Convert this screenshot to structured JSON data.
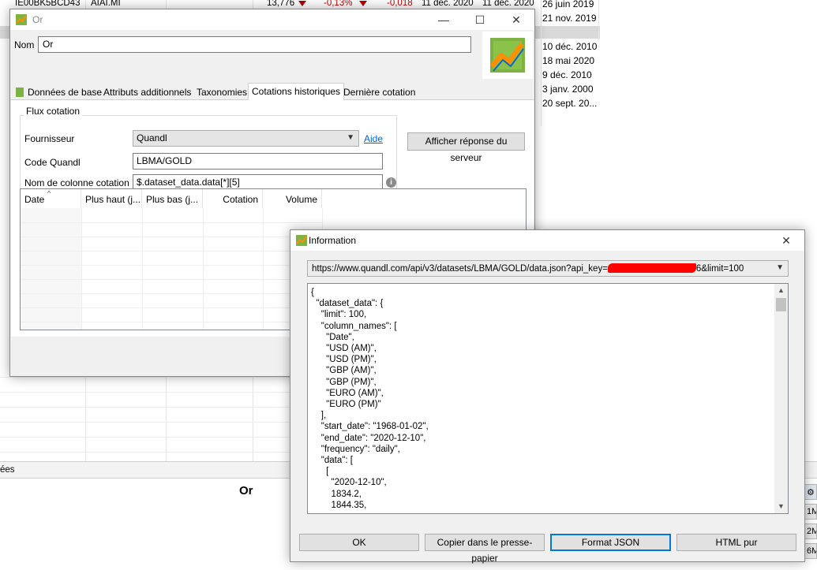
{
  "background": {
    "rows": [
      {
        "code": "IE00BK5BCD43",
        "ticker": "AIAI.MI",
        "price": "13,776",
        "change_pct": "-0,13%",
        "change": "-0,018",
        "date1": "11 déc. 2020",
        "date2": "11 déc. 2020"
      }
    ],
    "right_dates": [
      "26 juin 2019",
      "21 nov. 2019",
      "10 déc. 2010",
      "18 mai 2020",
      "9 déc. 2010",
      "3 janv. 2000",
      "20 sept. 20..."
    ],
    "tab_strip_text": "ées",
    "chart_title": "Or",
    "side_buttons": [
      "1M",
      "2M",
      "6M"
    ]
  },
  "or_window": {
    "title": "Or",
    "controls": {
      "minimize": "—",
      "maximize": "☐",
      "close": "✕"
    },
    "nom_label": "Nom",
    "nom_value": "Or",
    "tabs": [
      {
        "label": "Données de base"
      },
      {
        "label": "Attributs additionnels"
      },
      {
        "label": "Taxonomies"
      },
      {
        "label": "Cotations historiques"
      },
      {
        "label": "Dernière cotation"
      }
    ],
    "active_tab": "Cotations historiques",
    "group_title": "Flux cotation",
    "fournisseur_label": "Fournisseur",
    "fournisseur_value": "Quandl",
    "aide_link": "Aide",
    "code_label": "Code Quandl",
    "code_value": "LBMA/GOLD",
    "colonne_label": "Nom de colonne cotation",
    "colonne_value": "$.dataset_data.data[*][5]",
    "server_button": "Afficher réponse du serveur",
    "grid_columns": [
      "Date",
      "Plus haut (j...",
      "Plus bas (j...",
      "Cotation",
      "Volume"
    ]
  },
  "info_window": {
    "title": "Information",
    "close": "✕",
    "url_prefix": "https://www.quandl.com/api/v3/datasets/LBMA/GOLD/data.json?api_key=",
    "url_suffix": "6&limit=100",
    "json_lines": [
      "{",
      "  \"dataset_data\": {",
      "    \"limit\": 100,",
      "    \"column_names\": [",
      "      \"Date\",",
      "      \"USD (AM)\",",
      "      \"USD (PM)\",",
      "      \"GBP (AM)\",",
      "      \"GBP (PM)\",",
      "      \"EURO (AM)\",",
      "      \"EURO (PM)\"",
      "    ],",
      "    \"start_date\": \"1968-01-02\",",
      "    \"end_date\": \"2020-12-10\",",
      "    \"frequency\": \"daily\",",
      "    \"data\": [",
      "      [",
      "        \"2020-12-10\",",
      "        1834.2,",
      "        1844.35,"
    ],
    "buttons": {
      "ok": "OK",
      "copy": "Copier dans le presse-papier",
      "format_json": "Format JSON",
      "html": "HTML pur"
    },
    "colors": {
      "redaction": "#ff0000",
      "focus": "#0078d7"
    }
  }
}
